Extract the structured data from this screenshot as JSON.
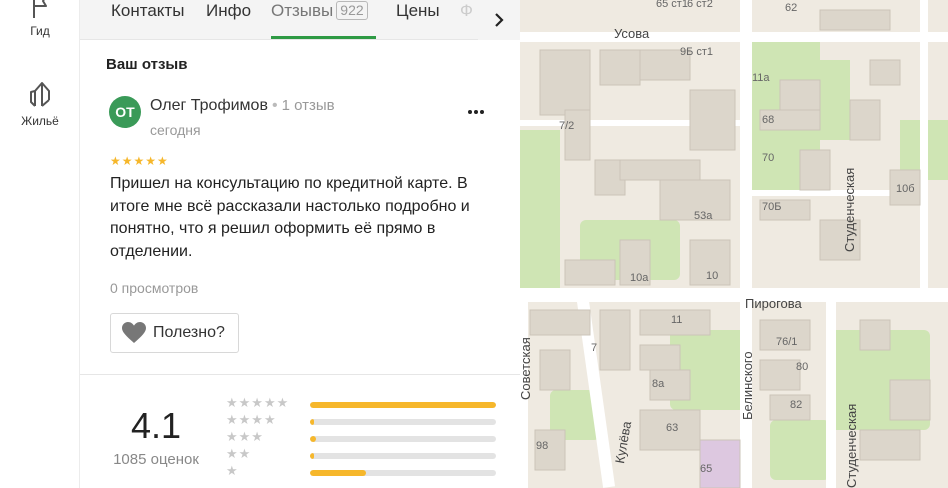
{
  "rail": {
    "guide_label": "Гид",
    "housing_label": "Жильё"
  },
  "tabs": {
    "contacts": "Контакты",
    "info": "Инфо",
    "reviews": "Отзывы",
    "reviews_count": "922",
    "prices": "Цены",
    "photos_partial": "Ф"
  },
  "review": {
    "section_title": "Ваш отзыв",
    "avatar_initials": "ОТ",
    "author": "Олег Трофимов",
    "author_reviews": "1 отзыв",
    "date": "сегодня",
    "stars": "★★★★★",
    "rating": 5,
    "text": "Пришел на консультацию по кредитной карте. В итоге мне всё рассказали настолько подробно и понятно, что я решил оформить её прямо в отделении.",
    "views": "0 просмотров",
    "useful_label": "Полезно?"
  },
  "summary": {
    "rating": "4.1",
    "count_label": "1085 оценок",
    "distribution": [
      {
        "stars": "★★★★★",
        "share": 1.0
      },
      {
        "stars": "★★★★",
        "share": 0.02
      },
      {
        "stars": "★★★",
        "share": 0.03
      },
      {
        "stars": "★★",
        "share": 0.02
      },
      {
        "stars": "★",
        "share": 0.3
      }
    ]
  },
  "map": {
    "streets": {
      "usova": "Усова",
      "pirogova": "Пирогова",
      "studencheskaya": "Студенческая",
      "belinskogo": "Белинского",
      "kuleva": "Кулёва",
      "sovetskaya_partial": "Советская",
      "studencheskaya_lower": "Студенческая"
    },
    "buildings": [
      "62",
      "65 ст1",
      "6 ст2",
      "9Б ст1",
      "11а",
      "7/2",
      "68",
      "70",
      "10б",
      "70Б",
      "53а",
      "10а",
      "10",
      "11",
      "7",
      "76/1",
      "80",
      "8а",
      "82",
      "63",
      "98",
      "65"
    ],
    "colors": {
      "accent_green": "#2e9a44",
      "star_yellow": "#f6b72b",
      "map_land": "#efeae1",
      "map_green": "#cfe5b4",
      "building": "#dcd6cb"
    }
  }
}
